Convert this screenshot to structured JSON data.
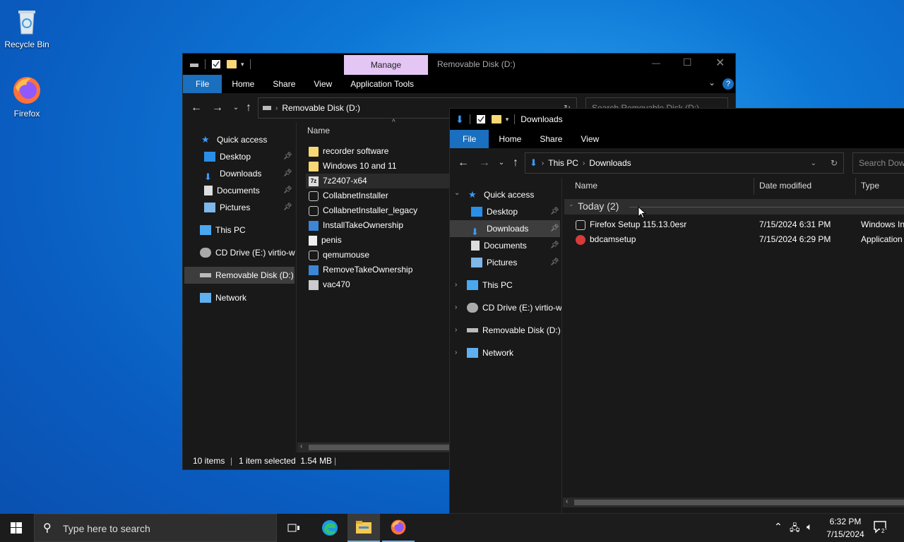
{
  "desktop": {
    "icons": [
      {
        "label": "Recycle Bin",
        "icon": "recycle-bin-icon"
      },
      {
        "label": "Firefox",
        "icon": "firefox-icon"
      }
    ]
  },
  "win1": {
    "title": "Removable Disk (D:)",
    "context_tab": "Manage",
    "tabs": [
      "File",
      "Home",
      "Share",
      "View",
      "Application Tools"
    ],
    "address": "Removable Disk (D:)",
    "search_placeholder": "Search Removable Disk (D:)",
    "nav": {
      "quick_access": "Quick access",
      "pinned": [
        "Desktop",
        "Downloads",
        "Documents",
        "Pictures"
      ],
      "this_pc": "This PC",
      "cd_drive": "CD Drive (E:) virtio-w",
      "removable": "Removable Disk (D:)",
      "network": "Network"
    },
    "column_name": "Name",
    "files": [
      {
        "name": "recorder software",
        "icon": "folder-icon"
      },
      {
        "name": "Windows 10 and 11",
        "icon": "folder-icon"
      },
      {
        "name": "7z2407-x64",
        "icon": "7zip-icon"
      },
      {
        "name": "CollabnetInstaller",
        "icon": "installer-icon"
      },
      {
        "name": "CollabnetInstaller_legacy",
        "icon": "installer-icon"
      },
      {
        "name": "InstallTakeOwnership",
        "icon": "registry-icon"
      },
      {
        "name": "penis",
        "icon": "text-file-icon"
      },
      {
        "name": "qemumouse",
        "icon": "installer-icon"
      },
      {
        "name": "RemoveTakeOwnership",
        "icon": "registry-icon"
      },
      {
        "name": "vac470",
        "icon": "app-icon"
      }
    ],
    "status": {
      "items": "10 items",
      "selected": "1 item selected  1.54 MB"
    }
  },
  "win2": {
    "title": "Downloads",
    "tabs": [
      "File",
      "Home",
      "Share",
      "View"
    ],
    "address": {
      "part1": "This PC",
      "part2": "Downloads"
    },
    "search_placeholder": "Search Downloads",
    "nav": {
      "quick_access": "Quick access",
      "pinned": [
        "Desktop",
        "Downloads",
        "Documents",
        "Pictures"
      ],
      "this_pc": "This PC",
      "cd_drive": "CD Drive (E:) virtio-w",
      "removable": "Removable Disk (D:)",
      "network": "Network"
    },
    "columns": {
      "name": "Name",
      "date": "Date modified",
      "type": "Type"
    },
    "group": "Today (2)",
    "files": [
      {
        "name": "Firefox Setup 115.13.0esr",
        "date": "7/15/2024 6:31 PM",
        "type": "Windows In",
        "icon": "installer-icon"
      },
      {
        "name": "bdcamsetup",
        "date": "7/15/2024 6:29 PM",
        "type": "Application",
        "icon": "bandicam-icon"
      }
    ]
  },
  "taskbar": {
    "search_placeholder": "Type here to search",
    "time": "6:32 PM",
    "date": "7/15/2024",
    "accent": "#0078d7"
  }
}
